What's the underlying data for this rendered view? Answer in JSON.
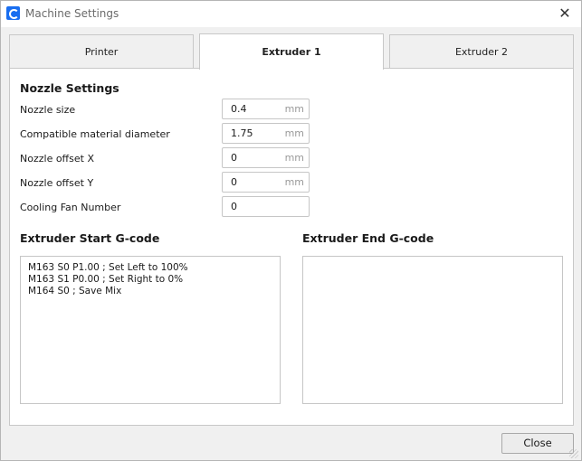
{
  "window": {
    "title": "Machine Settings",
    "close_glyph": "✕",
    "app_icon": "cura-logo-icon"
  },
  "tabs": [
    {
      "label": "Printer",
      "active": false
    },
    {
      "label": "Extruder 1",
      "active": true
    },
    {
      "label": "Extruder 2",
      "active": false
    }
  ],
  "nozzle_settings": {
    "title": "Nozzle Settings",
    "fields": [
      {
        "label": "Nozzle size",
        "value": "0.4",
        "unit": "mm"
      },
      {
        "label": "Compatible material diameter",
        "value": "1.75",
        "unit": "mm"
      },
      {
        "label": "Nozzle offset X",
        "value": "0",
        "unit": "mm"
      },
      {
        "label": "Nozzle offset Y",
        "value": "0",
        "unit": "mm"
      },
      {
        "label": "Cooling Fan Number",
        "value": "0",
        "unit": ""
      }
    ]
  },
  "start_gcode": {
    "title": "Extruder Start G-code",
    "content": "M163 S0 P1.00 ; Set Left to 100%\nM163 S1 P0.00 ; Set Right to 0%\nM164 S0 ; Save Mix"
  },
  "end_gcode": {
    "title": "Extruder End G-code",
    "content": ""
  },
  "footer": {
    "close_label": "Close"
  },
  "colors": {
    "accent": "#196ef0",
    "panel_bg": "#ffffff",
    "window_bg": "#f0f0f0"
  }
}
